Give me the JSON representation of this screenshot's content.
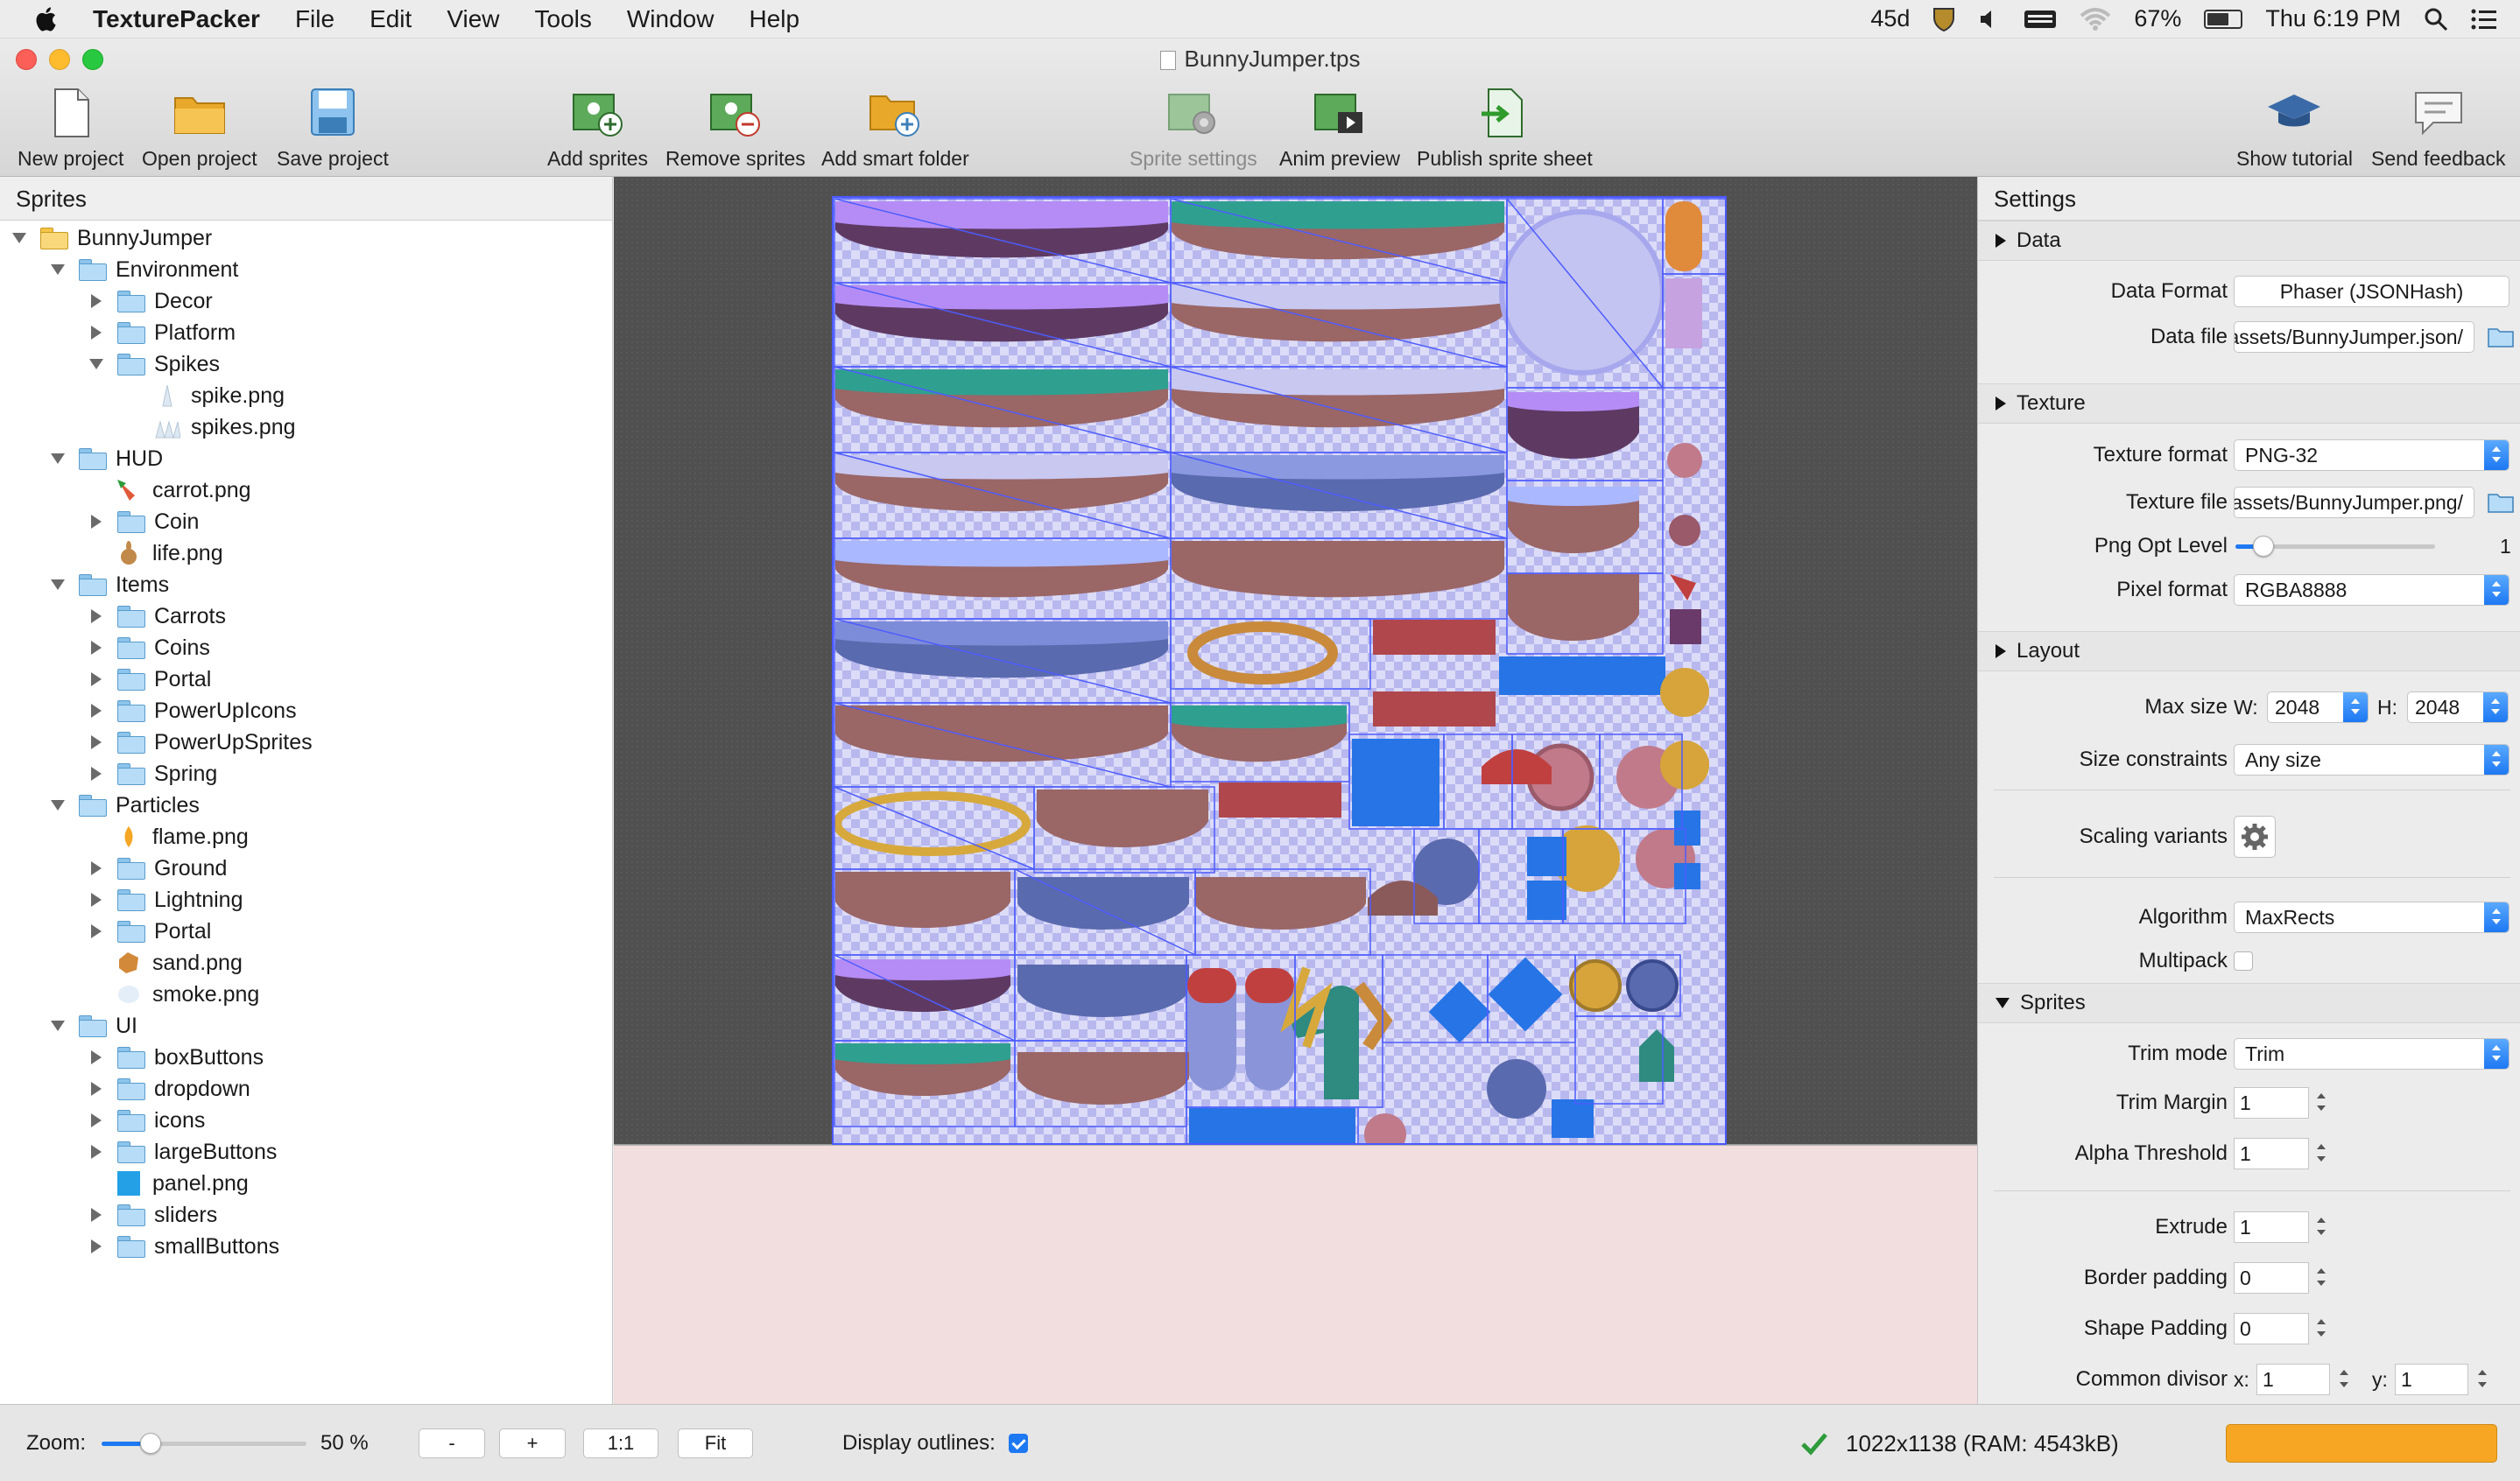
{
  "menubar": {
    "app_name": "TexturePacker",
    "menus": [
      "File",
      "Edit",
      "View",
      "Tools",
      "Window",
      "Help"
    ],
    "status_45d": "45d",
    "battery_percent": "67%",
    "clock": "Thu 6:19 PM"
  },
  "window": {
    "title": "BunnyJumper.tps"
  },
  "toolbar": {
    "new_project": "New project",
    "open_project": "Open project",
    "save_project": "Save project",
    "add_sprites": "Add sprites",
    "remove_sprites": "Remove sprites",
    "add_smart_folder": "Add smart folder",
    "sprite_settings": "Sprite settings",
    "anim_preview": "Anim preview",
    "publish": "Publish sprite sheet",
    "show_tutorial": "Show tutorial",
    "send_feedback": "Send feedback"
  },
  "sprites_panel": {
    "header": "Sprites",
    "tree": [
      {
        "label": "BunnyJumper",
        "level": 0,
        "type": "smart",
        "expanded": true
      },
      {
        "label": "Environment",
        "level": 1,
        "type": "folder",
        "expanded": true
      },
      {
        "label": "Decor",
        "level": 2,
        "type": "folder",
        "expanded": false
      },
      {
        "label": "Platform",
        "level": 2,
        "type": "folder",
        "expanded": false
      },
      {
        "label": "Spikes",
        "level": 2,
        "type": "folder",
        "expanded": true
      },
      {
        "label": "spike.png",
        "level": 3,
        "type": "spike"
      },
      {
        "label": "spikes.png",
        "level": 3,
        "type": "spikes"
      },
      {
        "label": "HUD",
        "level": 1,
        "type": "folder",
        "expanded": true
      },
      {
        "label": "carrot.png",
        "level": 2,
        "type": "carrot"
      },
      {
        "label": "Coin",
        "level": 2,
        "type": "folder",
        "expanded": false
      },
      {
        "label": "life.png",
        "level": 2,
        "type": "life"
      },
      {
        "label": "Items",
        "level": 1,
        "type": "folder",
        "expanded": true
      },
      {
        "label": "Carrots",
        "level": 2,
        "type": "folder",
        "expanded": false
      },
      {
        "label": "Coins",
        "level": 2,
        "type": "folder",
        "expanded": false
      },
      {
        "label": "Portal",
        "level": 2,
        "type": "folder",
        "expanded": false
      },
      {
        "label": "PowerUpIcons",
        "level": 2,
        "type": "folder",
        "expanded": false
      },
      {
        "label": "PowerUpSprites",
        "level": 2,
        "type": "folder",
        "expanded": false
      },
      {
        "label": "Spring",
        "level": 2,
        "type": "folder",
        "expanded": false
      },
      {
        "label": "Particles",
        "level": 1,
        "type": "folder",
        "expanded": true
      },
      {
        "label": "flame.png",
        "level": 2,
        "type": "flame"
      },
      {
        "label": "Ground",
        "level": 2,
        "type": "folder",
        "expanded": false
      },
      {
        "label": "Lightning",
        "level": 2,
        "type": "folder",
        "expanded": false
      },
      {
        "label": "Portal",
        "level": 2,
        "type": "folder",
        "expanded": false
      },
      {
        "label": "sand.png",
        "level": 2,
        "type": "sand"
      },
      {
        "label": "smoke.png",
        "level": 2,
        "type": "smoke"
      },
      {
        "label": "UI",
        "level": 1,
        "type": "folder",
        "expanded": true
      },
      {
        "label": "boxButtons",
        "level": 2,
        "type": "folder",
        "expanded": false
      },
      {
        "label": "dropdown",
        "level": 2,
        "type": "folder",
        "expanded": false
      },
      {
        "label": "icons",
        "level": 2,
        "type": "folder",
        "expanded": false
      },
      {
        "label": "largeButtons",
        "level": 2,
        "type": "folder",
        "expanded": false
      },
      {
        "label": "panel.png",
        "level": 2,
        "type": "panel"
      },
      {
        "label": "sliders",
        "level": 2,
        "type": "folder",
        "expanded": false
      },
      {
        "label": "smallButtons",
        "level": 2,
        "type": "folder",
        "expanded": false
      }
    ]
  },
  "settings": {
    "header": "Settings",
    "data_section": "Data",
    "data_format_label": "Data Format",
    "data_format_value": "Phaser (JSONHash)",
    "data_file_label": "Data file",
    "data_file_value": "/assets/BunnyJumper.json",
    "texture_section": "Texture",
    "texture_format_label": "Texture format",
    "texture_format_value": "PNG-32",
    "texture_file_label": "Texture file",
    "texture_file_value": "/assets/BunnyJumper.png",
    "png_opt_label": "Png Opt Level",
    "png_opt_value": "1",
    "png_opt_level_fraction": 0.14,
    "pixel_format_label": "Pixel format",
    "pixel_format_value": "RGBA8888",
    "layout_section": "Layout",
    "max_size_label": "Max size",
    "w_label": "W:",
    "w_value": "2048",
    "h_label": "H:",
    "h_value": "2048",
    "size_constraints_label": "Size constraints",
    "size_constraints_value": "Any size",
    "scaling_variants_label": "Scaling variants",
    "algorithm_label": "Algorithm",
    "algorithm_value": "MaxRects",
    "multipack_label": "Multipack",
    "sprites_section": "Sprites",
    "trim_mode_label": "Trim mode",
    "trim_mode_value": "Trim",
    "trim_margin_label": "Trim Margin",
    "trim_margin_value": "1",
    "alpha_threshold_label": "Alpha Threshold",
    "alpha_threshold_value": "1",
    "extrude_label": "Extrude",
    "extrude_value": "1",
    "border_padding_label": "Border padding",
    "border_padding_value": "0",
    "shape_padding_label": "Shape Padding",
    "shape_padding_value": "0",
    "common_divisor_label": "Common divisor",
    "x_label": "x:",
    "x_value": "1",
    "y_label": "y:",
    "y_value": "1"
  },
  "statusbar": {
    "zoom_label": "Zoom:",
    "zoom_value": "50 %",
    "zoom_level_fraction": 0.24,
    "minus": "-",
    "plus": "+",
    "one_to_one": "1:1",
    "fit": "Fit",
    "display_outlines_label": "Display outlines:",
    "sheet_info": "1022x1138 (RAM: 4543kB)"
  },
  "colors": {
    "accent": "#1d78f2",
    "publish_progress": "#f6a623",
    "sprite_outline": "#4b58ff",
    "preview_background": "#f2dede"
  }
}
